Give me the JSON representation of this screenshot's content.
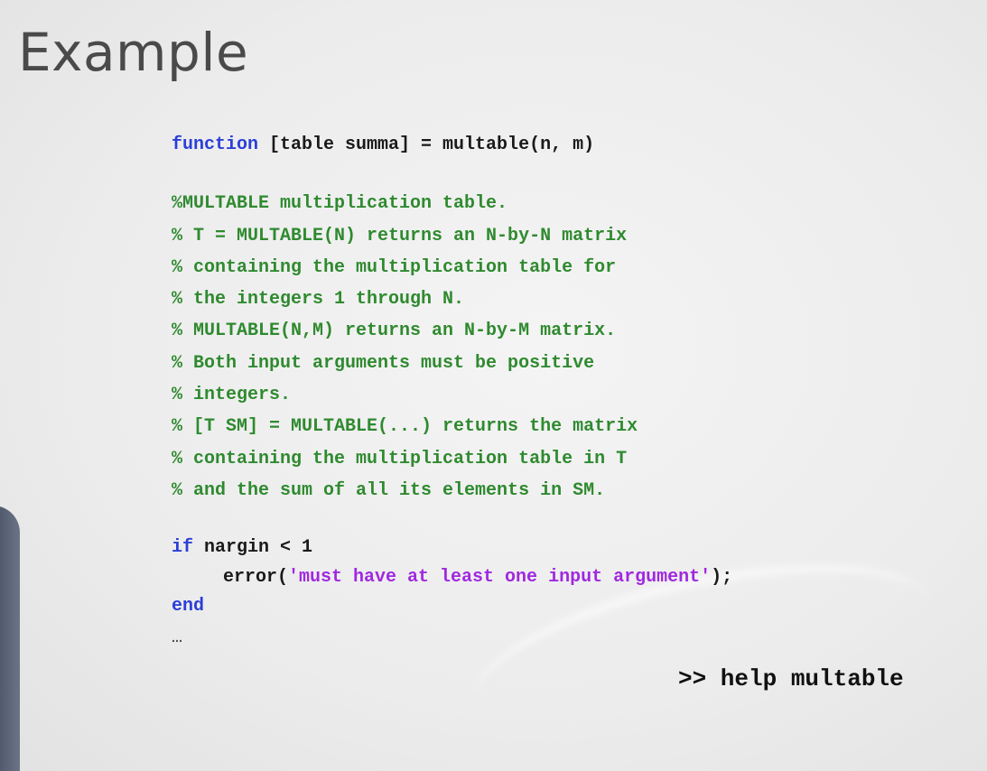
{
  "slide": {
    "title": "Example",
    "command": ">> help multable"
  },
  "code": {
    "signature": {
      "keyword": "function",
      "rest": " [table summa] = multable(n, m)"
    },
    "comments": [
      "%MULTABLE multiplication table.",
      "% T = MULTABLE(N) returns an N-by-N matrix",
      "% containing the multiplication table for",
      "% the integers 1 through N.",
      "% MULTABLE(N,M) returns an N-by-M matrix.",
      "% Both input arguments must be positive",
      "% integers.",
      "% [T SM] = MULTABLE(...) returns the matrix",
      "% containing the multiplication table in T",
      "% and the sum of all its elements in SM."
    ],
    "if_block": {
      "if_keyword": "if",
      "condition": " nargin < 1",
      "call_open": "error(",
      "message": "'must have at least one input argument'",
      "call_close": ");",
      "end_keyword": "end"
    },
    "ellipsis": "…"
  }
}
